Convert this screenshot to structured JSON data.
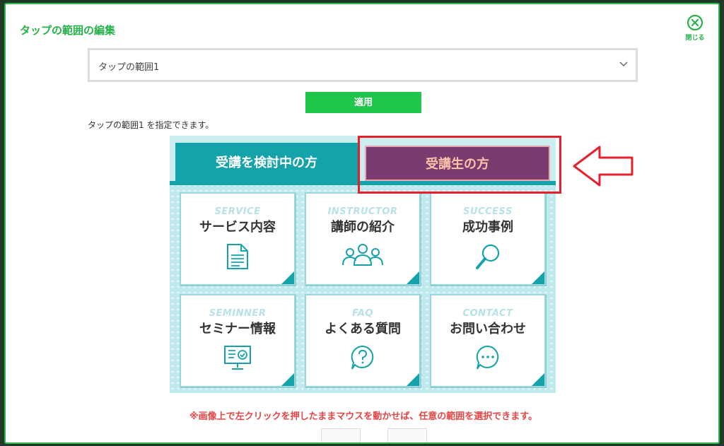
{
  "modal": {
    "title": "タップの範囲の編集",
    "close_label": "閉じる"
  },
  "select": {
    "value": "タップの範囲1"
  },
  "apply_label": "適用",
  "help_text": "タップの範囲1 を指定できます。",
  "preview": {
    "tab_prospective": "受講を検討中の方",
    "tab_students": "受講生の方",
    "cards": [
      {
        "en": "SERVICE",
        "ja": "サービス内容",
        "icon": "document-icon"
      },
      {
        "en": "INSTRUCTOR",
        "ja": "講師の紹介",
        "icon": "people-icon"
      },
      {
        "en": "SUCCESS",
        "ja": "成功事例",
        "icon": "magnifier-icon"
      },
      {
        "en": "SEMINNER",
        "ja": "セミナー情報",
        "icon": "monitor-check-icon"
      },
      {
        "en": "FAQ",
        "ja": "よくある質問",
        "icon": "question-bubble-icon"
      },
      {
        "en": "CONTACT",
        "ja": "お問い合わせ",
        "icon": "chat-bubble-icon"
      }
    ]
  },
  "notice": "※画像上で左クリックを押したままマウスを動かせば、任意の範囲を選択できます。",
  "colors": {
    "accent_green": "#25b24a",
    "teal": "#14a3aa",
    "purple_tab": "#7a3c6e",
    "highlight_red": "#e5202d"
  }
}
